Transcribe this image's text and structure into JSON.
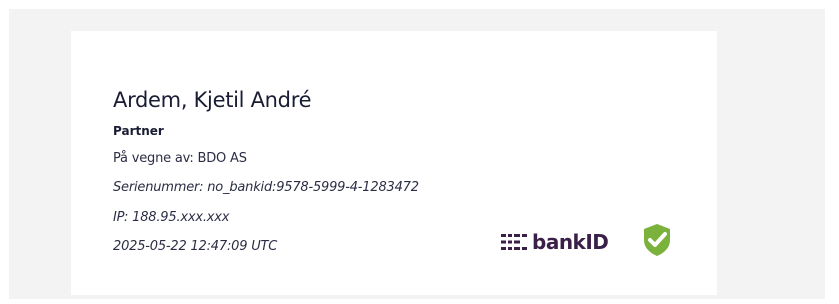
{
  "signature": {
    "name": "Ardem, Kjetil André",
    "role": "Partner",
    "on_behalf": "På vegne av: BDO AS",
    "serial": "Serienummer: no_bankid:9578-5999-4-1283472",
    "ip": "IP: 188.95.xxx.xxx",
    "timestamp": "2025-05-22 12:47:09 UTC"
  },
  "logo": {
    "brand": "bankID",
    "brand_icon": "bankid-logo-icon",
    "verified_icon": "check-shield-icon",
    "brand_color": "#3a1f49",
    "verified_color": "#7ab23c"
  }
}
